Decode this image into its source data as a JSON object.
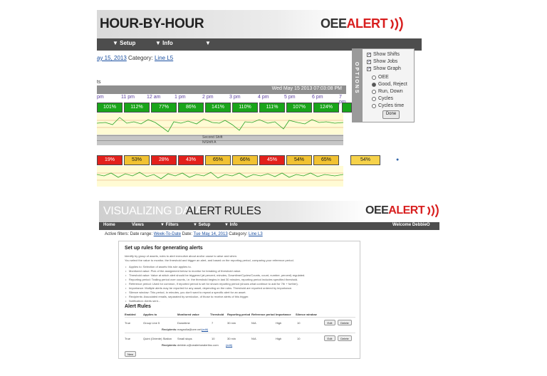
{
  "top": {
    "title": "HOUR-BY-HOUR",
    "logo": {
      "oee": "OEE",
      "alert": "ALERT"
    },
    "nav": [
      "▼  Setup",
      "▼  Info",
      "▼"
    ],
    "filter": {
      "date": "ay 15, 2013",
      "category_label": "Category:",
      "category": "Line L5"
    },
    "graph_title": "ts",
    "datetime": "Wed May 15 2013 07:03:08 PM",
    "ticks": [
      "pm",
      "11 pm",
      "12 am",
      "1 pm",
      "2 pm",
      "3 pm",
      "4 pm",
      "5 pm",
      "6 pm",
      "7 pm"
    ],
    "row1": [
      {
        "v": "101%",
        "c": "g"
      },
      {
        "v": "112%",
        "c": "g"
      },
      {
        "v": "77%",
        "c": "g"
      },
      {
        "v": "86%",
        "c": "g"
      },
      {
        "v": "141%",
        "c": "g"
      },
      {
        "v": "110%",
        "c": "g"
      },
      {
        "v": "111%",
        "c": "g"
      },
      {
        "v": "107%",
        "c": "g"
      },
      {
        "v": "124%",
        "c": "g"
      }
    ],
    "row2": [
      {
        "v": "19%",
        "c": "r"
      },
      {
        "v": "53%",
        "c": "y"
      },
      {
        "v": "28%",
        "c": "r"
      },
      {
        "v": "43%",
        "c": "r"
      },
      {
        "v": "65%",
        "c": "y"
      },
      {
        "v": "66%",
        "c": "y"
      },
      {
        "v": "45%",
        "c": "r"
      },
      {
        "v": "54%",
        "c": "y"
      },
      {
        "v": "65%",
        "c": "y"
      }
    ],
    "row2_total": "54%",
    "shift_label": "Second Shift",
    "shift_sub": "N/Shift A",
    "colors": {
      "green": "#19a51a",
      "yellow": "#f1c232",
      "red": "#e3201b",
      "nav": "#4d4d4d"
    }
  },
  "options": {
    "tab": "OPTIONS",
    "show_shifts": "Show Shifts",
    "show_jobs": "Show Jobs",
    "show_graph": "Show Graph",
    "radios": [
      {
        "label": "OEE",
        "on": false
      },
      {
        "label": "Good, Reject",
        "on": true
      },
      {
        "label": "Run, Down",
        "on": false
      },
      {
        "label": "Cycles",
        "on": false
      },
      {
        "label": "Cycles time",
        "on": false
      }
    ],
    "done": "Done"
  },
  "bottom": {
    "title_prefix": "VISUALIZING DATA",
    "title": "ALERT RULES",
    "logo": {
      "oee": "OEE",
      "alert": "ALERT"
    },
    "nav": [
      "Home",
      "Views",
      "▼  Filters",
      "▼  Setup",
      "▼  Info"
    ],
    "welcome": "Welcome DebbieO",
    "filters": {
      "prefix": "Active filters: Date range:",
      "range": "Week-To-Date",
      "date_label": "Date:",
      "date": "Tue May 14, 2013",
      "category_label": "Category:",
      "category": "Line L3"
    },
    "card": {
      "heading": "Set up rules for generating alerts",
      "intro1": "Identify by group of assets, rules to alert executive about and/or cause to arise and when.",
      "intro2": "You select the value to monitor, the threshold and trigger an alert, and based on the reporting period, comparing your reference period.",
      "bullets": [
        "Applies to: Selection of assets this rule applies to.",
        "Monitored value: Pick of the assignment below to monitor for breaking of threshold value.",
        "Threshold value: Value at which alert should be triggered (at percent, minutes, Downtime/Cycles/Counts, count, number, percent) regulated.",
        "Reporting period: Trailing period over counts, i.e. the threshold begins in last 30 minutes, reporting period includes specified threshold.",
        "Reference period: Used for common, if reported period is set for shown reporting period (shows what continue to add for 7th + further).",
        "Importance: Multiple alerts may be reported for any asset, depending on the rules. Threshold are reported ordered by importance.",
        "Silence window: This period, in minutes, you don't want to repeat a specific alert for an asset.",
        "Recipients: Associated emails, separated by semicolon, of those to receive alerts of this trigger.",
        "Notification: Alerts sent..."
      ],
      "rules_heading": "Alert Rules",
      "columns": [
        "Enabled",
        "Applies to",
        "Monitored value",
        "Threshold",
        "Reporting period",
        "Reference period",
        "Importance",
        "Silence window"
      ],
      "rules": [
        {
          "enabled": "True",
          "applies": "Group Line 5",
          "monitored": "Downtime",
          "threshold": "7",
          "reporting": "30 min",
          "reference": "N/A",
          "importance": "High",
          "silence": "10",
          "recipients_label": "Recipients:",
          "recipients": "magnolia@oee.net",
          "recipients_link": "(edit)"
        },
        {
          "enabled": "True",
          "applies": "Quint (Oriente) Station",
          "monitored": "Small stops",
          "threshold": "10",
          "reporting": "30 min",
          "reference": "N/A",
          "importance": "High",
          "silence": "10",
          "recipients_label": "Recipients:",
          "recipients": "debbie.o@oealertoealertinc.com",
          "recipients_link": "(edit)"
        }
      ],
      "edit": "Edit",
      "delete": "Delete",
      "new": "New"
    }
  }
}
